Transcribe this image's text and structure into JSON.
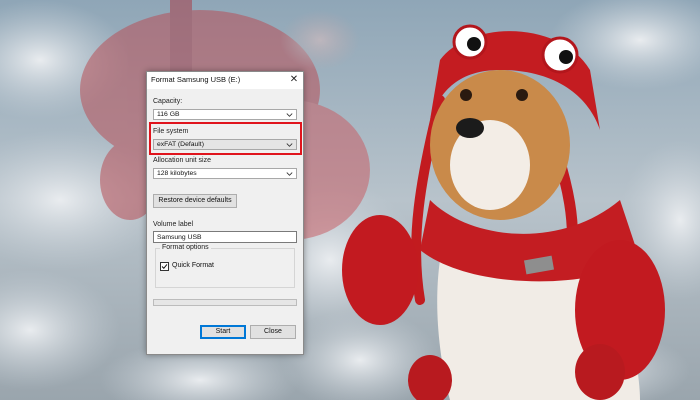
{
  "dialog": {
    "title": "Format Samsung USB (E:)",
    "capacity_label": "Capacity:",
    "capacity_value": "116 GB",
    "filesystem_label": "File system",
    "filesystem_value": "exFAT (Default)",
    "allocation_label": "Allocation unit size",
    "allocation_value": "128 kilobytes",
    "restore_label": "Restore device defaults",
    "volume_label": "Volume label",
    "volume_value": "Samsung USB",
    "format_options_label": "Format options",
    "quick_format_label": "Quick Format",
    "quick_format_checked": true,
    "progress": 0,
    "start_label": "Start",
    "close_label": "Close"
  },
  "highlight_color": "#e0141d",
  "icons": [
    "close-icon",
    "chevron-down-icon",
    "checkmark-icon"
  ]
}
